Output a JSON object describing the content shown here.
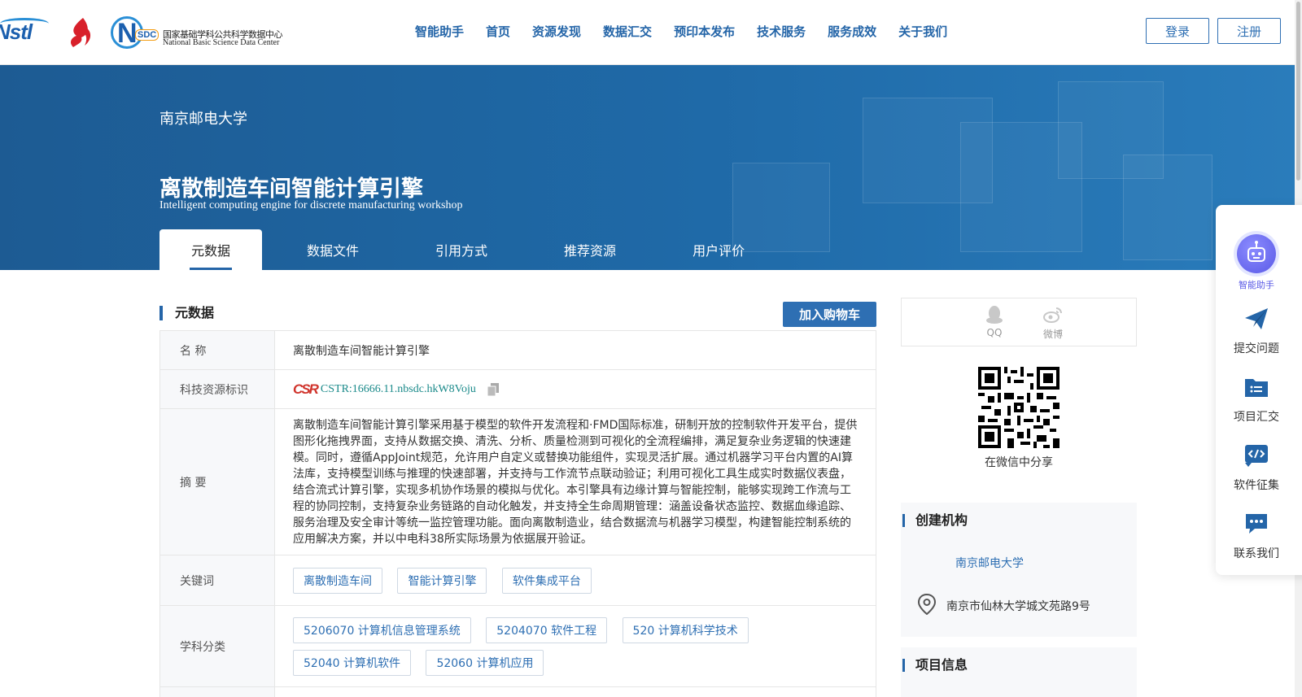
{
  "header": {
    "logo_nstl": "Nstl",
    "logo_nsdc_letters": "N",
    "logo_nsdc_badge": "SDC",
    "logo_nsdc_cn": "国家基础学科公共科学数据中心",
    "logo_nsdc_en": "National Basic Science Data Center",
    "nav": [
      "智能助手",
      "首页",
      "资源发现",
      "数据汇交",
      "预印本发布",
      "技术服务",
      "服务成效",
      "关于我们"
    ],
    "login_label": "登录",
    "register_label": "注册"
  },
  "banner": {
    "institution": "南京邮电大学",
    "title_cn": "离散制造车间智能计算引擎",
    "title_en": "Intelligent computing engine for discrete manufacturing workshop",
    "tabs": [
      "元数据",
      "数据文件",
      "引用方式",
      "推荐资源",
      "用户评价"
    ],
    "active_tab": "元数据"
  },
  "metadata": {
    "section_title": "元数据",
    "cart_label": "加入购物车",
    "name_key": "名 称",
    "name_value": "离散制造车间智能计算引擎",
    "id_key": "科技资源标识",
    "cstr_logo": "CSR",
    "cstr_value": "CSTR:16666.11.nbsdc.hkW8Voju",
    "abstract_key": "摘 要",
    "abstract_value": "离散制造车间智能计算引擎采用基于模型的软件开发流程和·FMD国际标准，研制开放的控制软件开发平台，提供图形化拖拽界面，支持从数据交换、清洗、分析、质量检测到可视化的全流程编排，满足复杂业务逻辑的快速建模。同时，遵循AppJoint规范，允许用户自定义或替换功能组件，实现灵活扩展。通过机器学习平台内置的AI算法库，支持模型训练与推理的快速部署，并支持与工作流节点联动验证；利用可视化工具生成实时数据仪表盘，结合流式计算引擎，实现多机协作场景的模拟与优化。本引擎具有边缘计算与智能控制，能够实现跨工作流与工程的协同控制，支持复杂业务链路的自动化触发，并支持全生命周期管理：涵盖设备状态监控、数据血缘追踪、服务治理及安全审计等统一监控管理功能。面向离散制造业，结合数据流与机器学习模型，构建智能控制系统的应用解决方案，并以中电科38所实际场景为依据展开验证。",
    "keywords_key": "关键词",
    "keywords": [
      "离散制造车间",
      "智能计算引擎",
      "软件集成平台"
    ],
    "subject_key": "学科分类",
    "subjects": [
      "5206070 计算机信息管理系统",
      "5204070 软件工程",
      "520 计算机科学技术",
      "52040 计算机软件",
      "52060 计算机应用"
    ]
  },
  "share": {
    "qq_label": "QQ",
    "weibo_label": "微博",
    "wechat_label": "在微信中分享"
  },
  "creator": {
    "title": "创建机构",
    "name": "南京邮电大学",
    "address": "南京市仙林大学城文苑路9号"
  },
  "project": {
    "title": "项目信息"
  },
  "float_bar": {
    "ai_label": "智能助手",
    "submit_label": "提交问题",
    "project_label": "项目汇交",
    "software_label": "软件征集",
    "contact_label": "联系我们"
  },
  "colors": {
    "brand_blue": "#2465a8",
    "banner_blue": "#1f6aa8",
    "cstr_link": "#1a8a8a"
  }
}
